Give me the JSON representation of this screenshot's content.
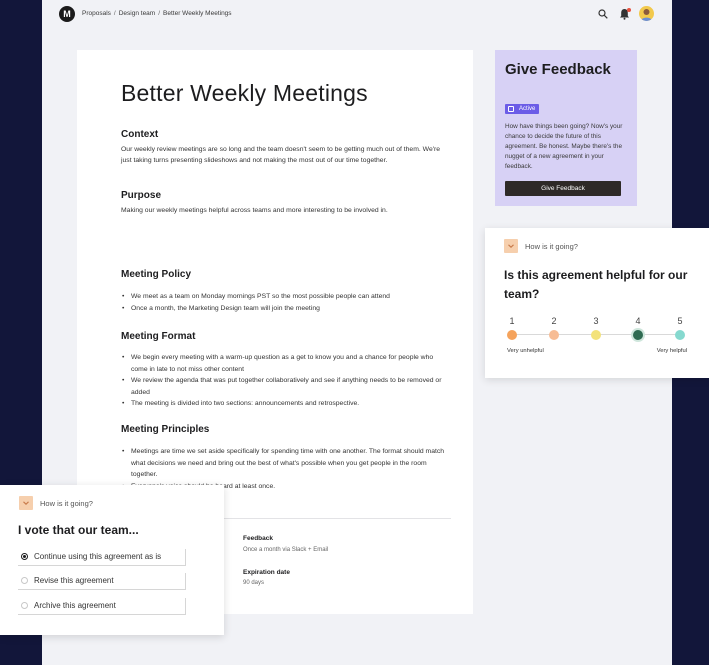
{
  "app": {
    "logo_letter": "M",
    "breadcrumb": [
      "Proposals",
      "Design team",
      "Better Weekly Meetings"
    ],
    "breadcrumb_sep": "/"
  },
  "document": {
    "title": "Better Weekly Meetings",
    "context_heading": "Context",
    "context_text": "Our weekly review meetings are so long and the team doesn't seem to be getting much out of them. We're just taking turns presenting slideshows and not making the most out of our time together.",
    "purpose_heading": "Purpose",
    "purpose_text": "Making our weekly meetings helpful across teams and more interesting to be involved in.",
    "policy_heading": "Meeting Policy",
    "policy_items": [
      "We meet as a team on Monday mornings PST so the most possible people can attend",
      "Once a month, the Marketing Design team will join the meeting"
    ],
    "format_heading": "Meeting Format",
    "format_items": [
      "We begin every meeting with a warm-up question as a get to know you and a chance for people who come in late to not miss other content",
      "We review the agenda that was put together collaboratively and see if anything needs to be removed or added",
      "The meeting is divided into two sections: announcements and retrospective."
    ],
    "principles_heading": "Meeting Principles",
    "principles_items": [
      "Meetings are time we set aside specifically for spending time with one another. The format should match what decisions we need and  bring out the best of what's possible when you get people in the room together.",
      "Everyone's voice should be heard at least once."
    ],
    "feedback_meta_title": "Feedback",
    "feedback_meta_text": "Once a month via Slack + Email",
    "expiration_meta_title": "Expiration date",
    "expiration_meta_text": "90 days"
  },
  "feedback_card": {
    "title": "Give Feedback",
    "badge": "Active",
    "description": "How have things been going? Now's your chance to decide the future of this agreement. Be honest. Maybe there's the nugget of a new agreement in your feedback.",
    "button": "Give Feedback",
    "bg_color": "#d7d1f5",
    "badge_color": "#6b5ce7"
  },
  "rating_popup": {
    "label": "How is it going?",
    "question": "Is this agreement helpful for our team?",
    "scale": [
      {
        "n": "1",
        "color": "#f5a35c"
      },
      {
        "n": "2",
        "color": "#f7bc94"
      },
      {
        "n": "3",
        "color": "#f3e27a"
      },
      {
        "n": "4",
        "color": "#2f6b52"
      },
      {
        "n": "5",
        "color": "#86d9cf"
      }
    ],
    "low_label": "Very unhelpful",
    "high_label": "Very helpful"
  },
  "vote_popup": {
    "label": "How is it going?",
    "question": "I vote that our team...",
    "options": [
      {
        "label": "Continue using this agreement as is",
        "selected": true
      },
      {
        "label": "Revise this agreement",
        "selected": false
      },
      {
        "label": "Archive this agreement",
        "selected": false
      }
    ]
  }
}
